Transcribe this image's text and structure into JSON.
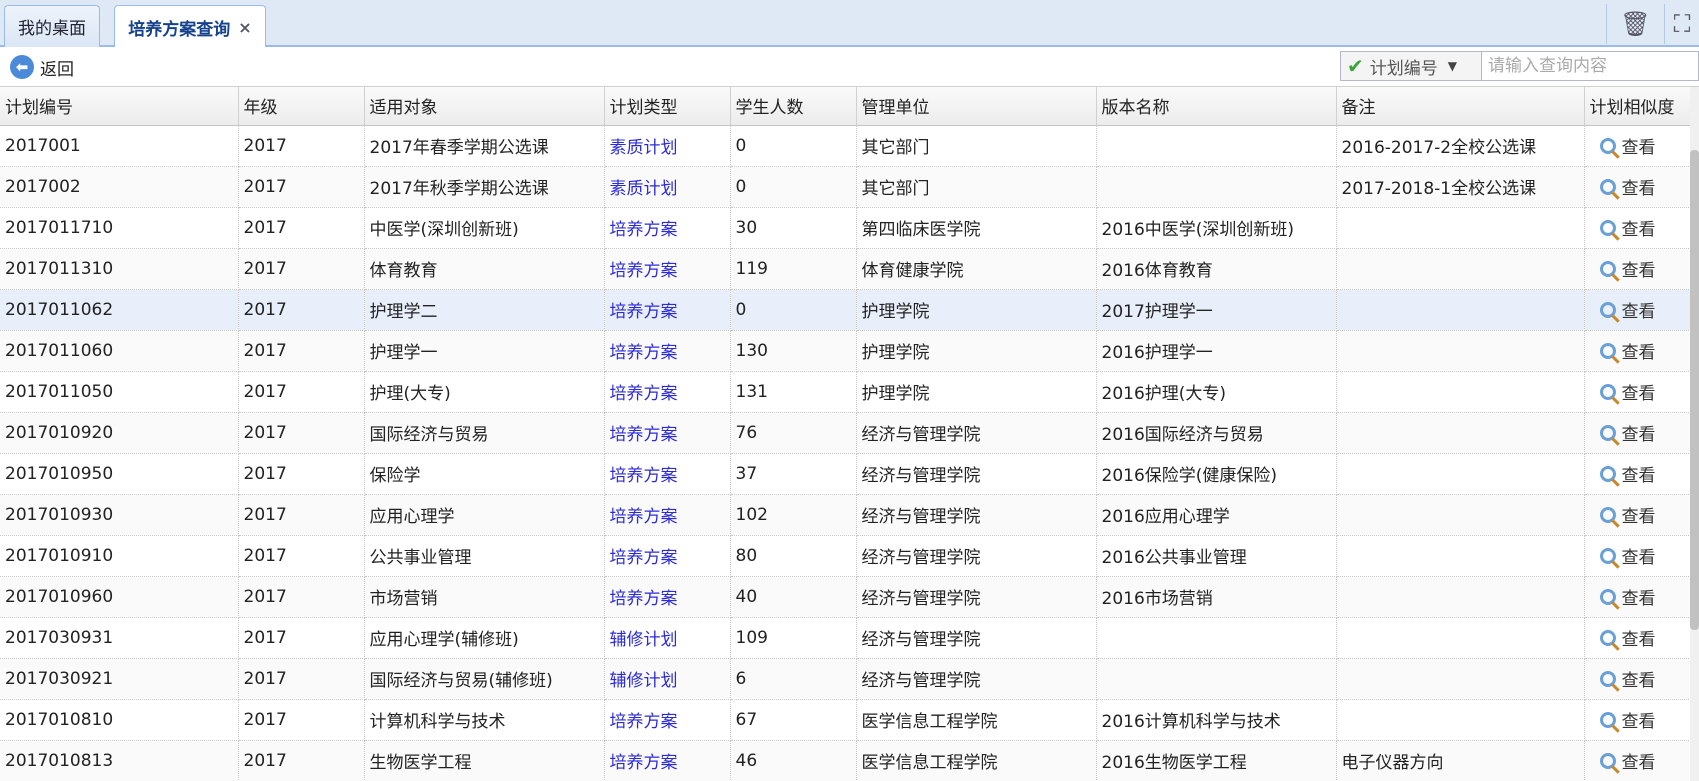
{
  "tabs": [
    {
      "label": "我的桌面",
      "active": false
    },
    {
      "label": "培养方案查询",
      "active": true,
      "close": "×"
    }
  ],
  "tab_tools": {
    "trash": "🗑",
    "fullscreen": "⛶"
  },
  "toolbar": {
    "back_label": "返回",
    "back_icon": "back-arrow-icon",
    "search_field": "计划编号",
    "search_placeholder": "请输入查询内容"
  },
  "columns": [
    "计划编号",
    "年级",
    "适用对象",
    "计划类型",
    "学生人数",
    "管理单位",
    "版本名称",
    "备注",
    "计划相似度"
  ],
  "view_label": "查看",
  "rows": [
    [
      "2017001",
      "2017",
      "2017年春季学期公选课",
      "素质计划",
      "0",
      "其它部门",
      "",
      "2016-2017-2全校公选课"
    ],
    [
      "2017002",
      "2017",
      "2017年秋季学期公选课",
      "素质计划",
      "0",
      "其它部门",
      "",
      "2017-2018-1全校公选课"
    ],
    [
      "2017011710",
      "2017",
      "中医学(深圳创新班)",
      "培养方案",
      "30",
      "第四临床医学院",
      "2016中医学(深圳创新班)",
      ""
    ],
    [
      "2017011310",
      "2017",
      "体育教育",
      "培养方案",
      "119",
      "体育健康学院",
      "2016体育教育",
      ""
    ],
    [
      "2017011062",
      "2017",
      "护理学二",
      "培养方案",
      "0",
      "护理学院",
      "2017护理学一",
      ""
    ],
    [
      "2017011060",
      "2017",
      "护理学一",
      "培养方案",
      "130",
      "护理学院",
      "2016护理学一",
      ""
    ],
    [
      "2017011050",
      "2017",
      "护理(大专)",
      "培养方案",
      "131",
      "护理学院",
      "2016护理(大专)",
      ""
    ],
    [
      "2017010920",
      "2017",
      "国际经济与贸易",
      "培养方案",
      "76",
      "经济与管理学院",
      "2016国际经济与贸易",
      ""
    ],
    [
      "2017010950",
      "2017",
      "保险学",
      "培养方案",
      "37",
      "经济与管理学院",
      "2016保险学(健康保险)",
      ""
    ],
    [
      "2017010930",
      "2017",
      "应用心理学",
      "培养方案",
      "102",
      "经济与管理学院",
      "2016应用心理学",
      ""
    ],
    [
      "2017010910",
      "2017",
      "公共事业管理",
      "培养方案",
      "80",
      "经济与管理学院",
      "2016公共事业管理",
      ""
    ],
    [
      "2017010960",
      "2017",
      "市场营销",
      "培养方案",
      "40",
      "经济与管理学院",
      "2016市场营销",
      ""
    ],
    [
      "2017030931",
      "2017",
      "应用心理学(辅修班)",
      "辅修计划",
      "109",
      "经济与管理学院",
      "",
      ""
    ],
    [
      "2017030921",
      "2017",
      "国际经济与贸易(辅修班)",
      "辅修计划",
      "6",
      "经济与管理学院",
      "",
      ""
    ],
    [
      "2017010810",
      "2017",
      "计算机科学与技术",
      "培养方案",
      "67",
      "医学信息工程学院",
      "2016计算机科学与技术",
      ""
    ],
    [
      "2017010813",
      "2017",
      "生物医学工程",
      "培养方案",
      "46",
      "医学信息工程学院",
      "2016生物医学工程",
      "电子仪器方向"
    ]
  ],
  "selected_row": 4,
  "colors": {
    "link": "#2b2bd9",
    "header_border": "#99bbe8",
    "selected": "#e8effa",
    "arrow": "#e53935"
  }
}
